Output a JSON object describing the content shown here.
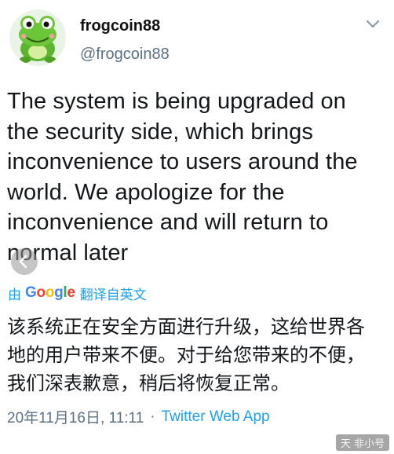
{
  "author": {
    "display_name": "frogcoin88",
    "handle": "@frogcoin88"
  },
  "tweet": {
    "text": "The system is being upgraded on the security side, which brings inconvenience to users around the world. We apologize for the inconvenience and will return to normal later",
    "translated_by_prefix": "由",
    "translator_brand": "Google",
    "translator_action": "翻译自英文",
    "translation": "该系统正在安全方面进行升级，这给世界各地的用户带来不便。对于给您带来的不便，我们深表歉意，稍后将恢复正常。",
    "date": "20年11月16日, 11:11",
    "separator": "·",
    "source": "Twitter Web App"
  },
  "watermark": "天 非小号",
  "colors": {
    "accent": "#1da1f2",
    "muted": "#5b7083",
    "text": "#14171a"
  },
  "icons": {
    "avatar": "frog-avatar",
    "menu": "chevron-down-icon",
    "back": "back-arrow-icon"
  }
}
